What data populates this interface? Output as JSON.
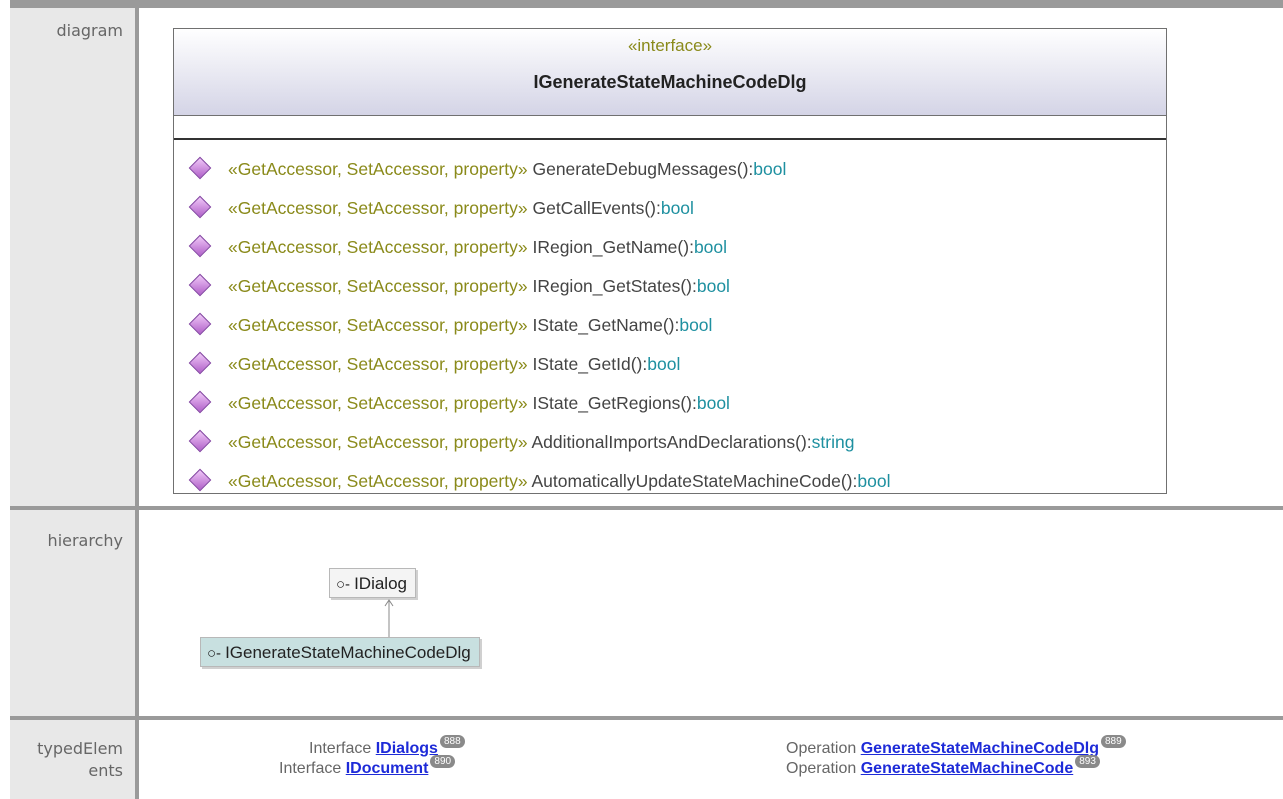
{
  "rows": {
    "diagram_label": "diagram",
    "hierarchy_label": "hierarchy",
    "typed_label": "typedElem ents"
  },
  "uml": {
    "stereotype": "«interface»",
    "class_name": "IGenerateStateMachineCodeDlg",
    "ops_stereotype": "«GetAccessor, SetAccessor, property»",
    "operations": [
      {
        "name": "GenerateDebugMessages():",
        "type": "bool"
      },
      {
        "name": "GetCallEvents():",
        "type": "bool"
      },
      {
        "name": "IRegion_GetName():",
        "type": "bool"
      },
      {
        "name": "IRegion_GetStates():",
        "type": "bool"
      },
      {
        "name": "IState_GetName():",
        "type": "bool"
      },
      {
        "name": "IState_GetId():",
        "type": "bool"
      },
      {
        "name": "IState_GetRegions():",
        "type": "bool"
      },
      {
        "name": "AdditionalImportsAndDeclarations():",
        "type": "string"
      },
      {
        "name": "AutomaticallyUpdateStateMachineCode():",
        "type": "bool"
      }
    ]
  },
  "hierarchy": {
    "parent": "IDialog",
    "child": "IGenerateStateMachineCodeDlg"
  },
  "typed": {
    "left": [
      {
        "kind": "Interface",
        "link": "IDialogs",
        "badge": "888"
      },
      {
        "kind": "Interface",
        "link": "IDocument",
        "badge": "890"
      }
    ],
    "right": [
      {
        "kind": "Operation",
        "link": "GenerateStateMachineCodeDlg",
        "badge": "889"
      },
      {
        "kind": "Operation",
        "link": "GenerateStateMachineCode",
        "badge": "893"
      }
    ]
  },
  "colors": {
    "stereotype": "#8a8a1a",
    "type": "#1e90a0",
    "link": "#1e2bd8",
    "hierarchy_child_bg": "#c8e0e0"
  }
}
